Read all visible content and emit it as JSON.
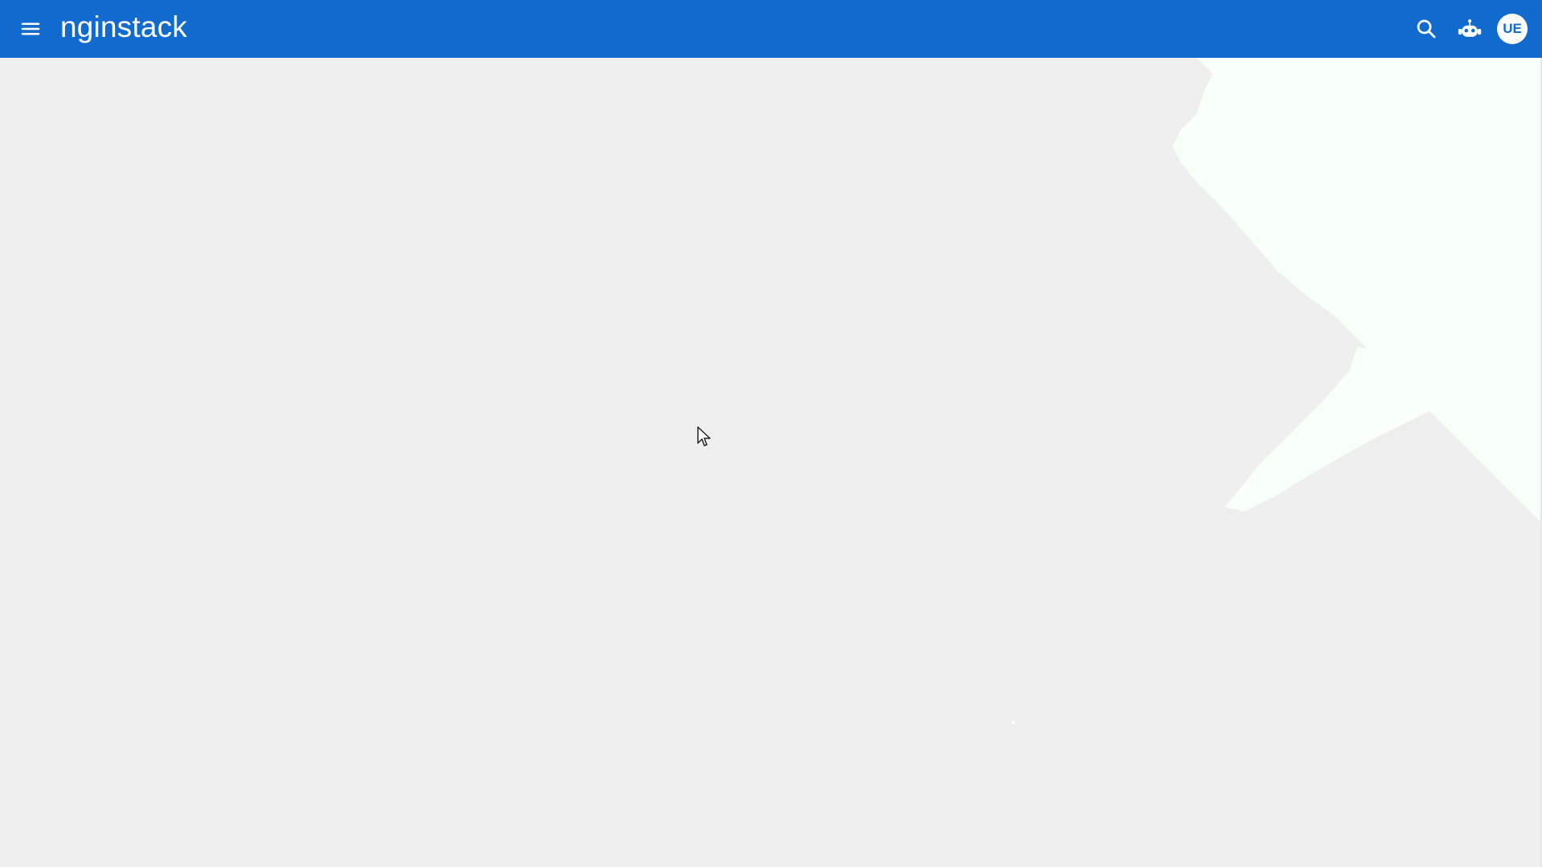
{
  "app": {
    "brand_text": "nginstack",
    "accent_color": "#116bcf",
    "background_color": "#efefef"
  },
  "header": {
    "menu_icon": "menu-icon",
    "search_icon": "search-icon",
    "assistant_icon": "robot-icon",
    "user": {
      "initials": "UE"
    }
  }
}
